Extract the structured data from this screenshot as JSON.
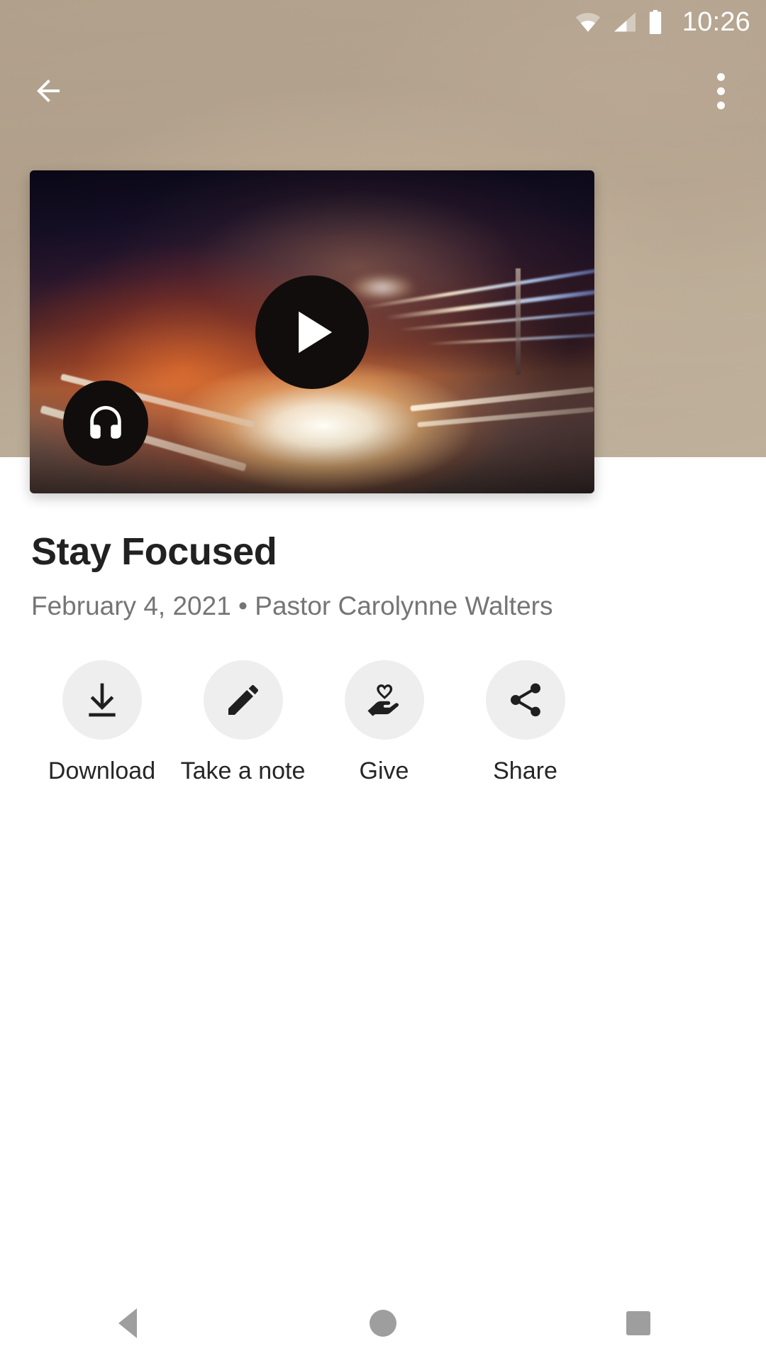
{
  "status_bar": {
    "time": "10:26",
    "icons": [
      "wifi-icon",
      "cellular-signal-icon",
      "battery-icon"
    ],
    "text_color": "#ffffff"
  },
  "app_bar": {
    "back_icon": "arrow-back-icon",
    "overflow_icon": "more-vertical-icon",
    "background_color": "#b2a18c"
  },
  "hero": {
    "play_icon": "play-triangle-icon",
    "audio_badge_icon": "headphones-icon",
    "artwork_description": "night highway light trails at sunset"
  },
  "detail": {
    "title": "Stay Focused",
    "subtitle": "February 4, 2021 • Pastor Carolynne Walters",
    "title_color": "#212121",
    "subtitle_color": "#757575"
  },
  "actions": [
    {
      "label": "Download",
      "icon": "download-icon"
    },
    {
      "label": "Take a note",
      "icon": "pencil-edit-icon"
    },
    {
      "label": "Give",
      "icon": "hand-heart-icon"
    },
    {
      "label": "Share",
      "icon": "share-nodes-icon"
    }
  ],
  "nav_bar": {
    "back": "triangle-back-icon",
    "home": "circle-home-icon",
    "recents": "square-recents-icon",
    "tint": "#9e9e9e"
  }
}
